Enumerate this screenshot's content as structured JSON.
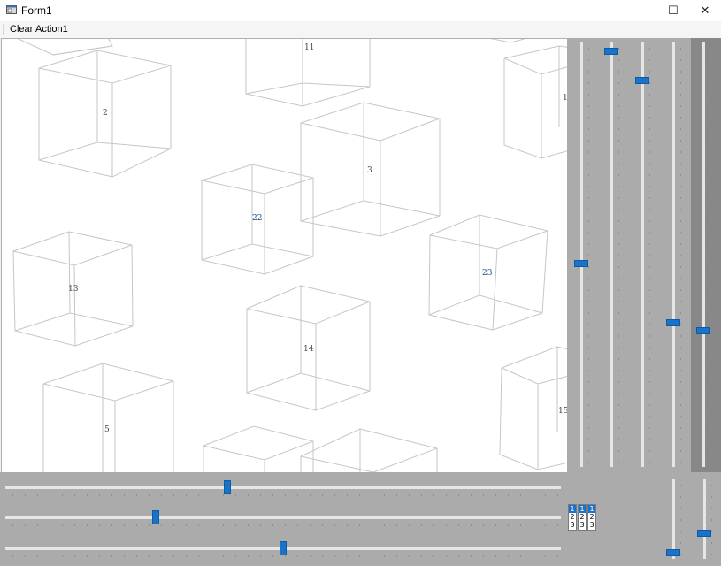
{
  "window": {
    "title": "Form1",
    "minimize": "—",
    "maximize": "☐",
    "close": "✕"
  },
  "menu": {
    "items": [
      "Clear",
      "Action1"
    ]
  },
  "canvas": {
    "cube_labels": [
      "11",
      "2",
      "1",
      "3",
      "22",
      "13",
      "23",
      "14",
      "5",
      "15"
    ]
  },
  "mini_control": {
    "columns": [
      [
        "1",
        "2",
        "3"
      ],
      [
        "1",
        "2",
        "3"
      ],
      [
        "1",
        "2",
        "3"
      ]
    ]
  },
  "sliders": {
    "vertical_right": [
      {
        "name": "v1",
        "value": 0.52
      },
      {
        "name": "v2",
        "value": 0.02
      },
      {
        "name": "v3",
        "value": 0.09
      },
      {
        "name": "v4",
        "value": 0.66
      },
      {
        "name": "v5",
        "value": 0.68
      }
    ],
    "horizontal_bottom": [
      {
        "name": "h1",
        "value": 0.4
      },
      {
        "name": "h2",
        "value": 0.27
      },
      {
        "name": "h3",
        "value": 0.5
      }
    ],
    "vertical_bottom": [
      {
        "name": "vb1",
        "value": 0.92
      },
      {
        "name": "vb2",
        "value": 0.68
      }
    ]
  }
}
